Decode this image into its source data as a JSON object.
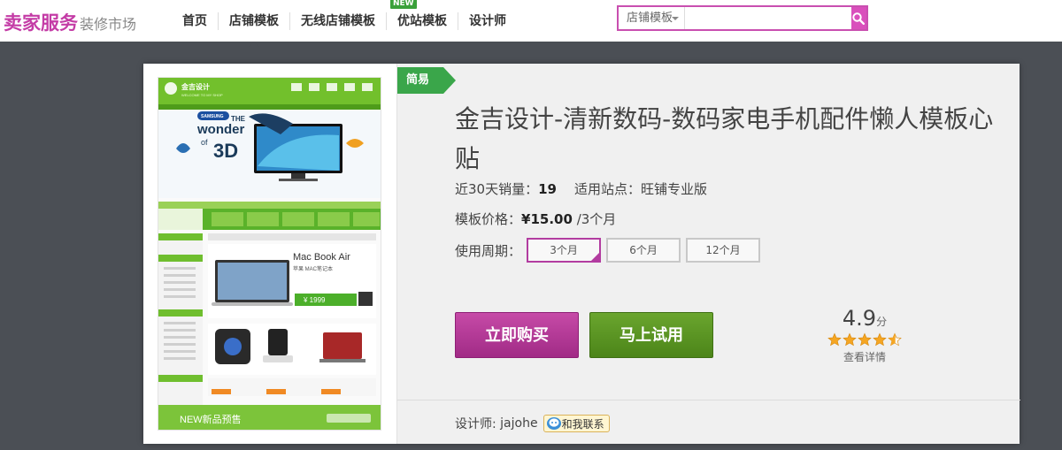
{
  "header": {
    "logo_main": "卖家服务",
    "logo_sub": "装修市场",
    "nav": [
      {
        "label": "首页"
      },
      {
        "label": "店铺模板"
      },
      {
        "label": "无线店铺模板"
      },
      {
        "label": "优站模板",
        "badge": "NEW"
      },
      {
        "label": "设计师"
      }
    ],
    "active_nav_index": 1,
    "search": {
      "selected_option": "店铺模板",
      "value": "",
      "placeholder": ""
    },
    "accent_color": "#c94fb0"
  },
  "thumbnail": {
    "shop_name": "金吉设计",
    "shop_tagline": "WELCOME TO MY SHOP",
    "banner_brand": "SAMSUNG",
    "banner_line1": "THE",
    "banner_line2": "wonder",
    "banner_line3": "of",
    "banner_line4": "3D",
    "promo_title": "Mac Book Air",
    "promo_sub": "苹果 MAC笔记本",
    "promo_price": "¥ 1999",
    "footer_label": "NEW新品预售"
  },
  "product": {
    "level_tag": "简易",
    "title": "金吉设计-清新数码-数码家电手机配件懒人模板心贴",
    "sales_label": "近30天销量：",
    "sales_value": "19",
    "site_label": "适用站点：",
    "site_value": "旺铺专业版",
    "price_label": "模板价格：",
    "price_value": "¥15.00",
    "price_unit": "/3个月",
    "period_label": "使用周期：",
    "periods": [
      "3个月",
      "6个月",
      "12个月"
    ],
    "selected_period_index": 0,
    "buy_label": "立即购买",
    "try_label": "马上试用",
    "rating_score": "4.9",
    "rating_unit": "分",
    "rating_stars": 4.9,
    "rating_detail": "查看详情",
    "designer_label": "设计师:",
    "designer_name": "jajohe",
    "contact_label": "和我联系",
    "buy_color": "#b23ca0",
    "try_color": "#5a9424",
    "tag_color": "#3aa64a"
  }
}
